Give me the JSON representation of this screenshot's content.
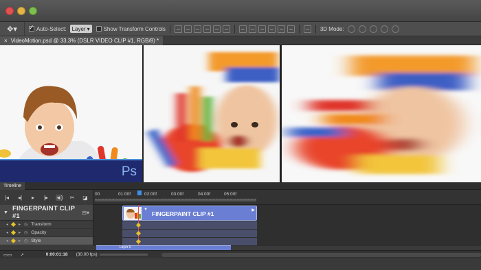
{
  "window": {
    "buttons": [
      "close",
      "minimize",
      "maximize"
    ]
  },
  "options_bar": {
    "tool_icon": "move-tool-icon",
    "auto_select_label": "Auto-Select:",
    "auto_select_checked": true,
    "auto_select_value": "Layer",
    "show_transform_label": "Show Transform Controls",
    "show_transform_checked": false,
    "mode_3d_label": "3D Mode:"
  },
  "document": {
    "tab_title": "VideoMotion.psd @ 33.3% (DSLR VIDEO CLIP #1, RGB/8) *",
    "close_glyph": "×"
  },
  "canvas": {
    "brand_logo": "Ps",
    "frames": [
      "sharp",
      "motion-blur",
      "heavy-motion-blur"
    ]
  },
  "timeline": {
    "panel_title": "Timeline",
    "ruler_ticks": [
      "00",
      "01:00f",
      "02:00f",
      "03:00f",
      "04:00f",
      "05:00f"
    ],
    "layer_name": "FINGERPAINT CLIP #1",
    "clip_name": "FINGERPAINT CLIP #1",
    "properties": [
      {
        "name": "Transform",
        "selected": false
      },
      {
        "name": "Opacity",
        "selected": false
      },
      {
        "name": "Style",
        "selected": true
      }
    ],
    "next_layer_label": "Layer 0",
    "current_time": "0:00:01:18",
    "frame_rate": "(30.00 fps)",
    "accent_color": "#6a7fd4",
    "keyframe_color": "#e7c12a"
  }
}
